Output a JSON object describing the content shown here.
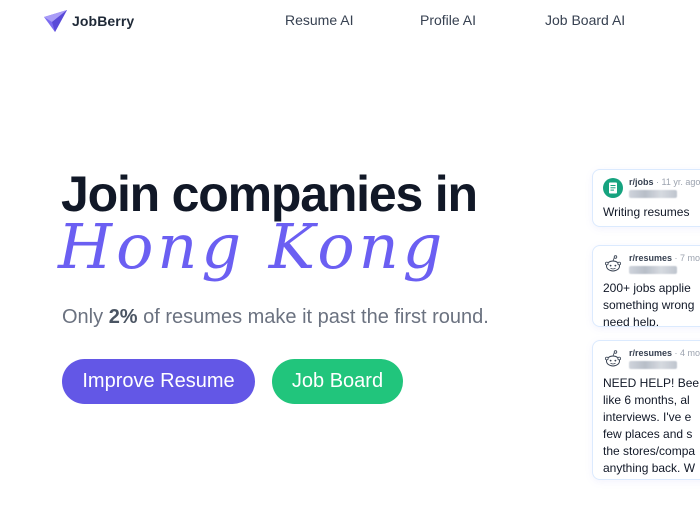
{
  "brand": {
    "name": "JobBerry",
    "accent": "#6357e6",
    "logo_icon": "paper-plane-icon"
  },
  "nav": [
    {
      "label": "Resume AI"
    },
    {
      "label": "Profile AI"
    },
    {
      "label": "Job Board AI"
    }
  ],
  "hero": {
    "headline": "Join companies in",
    "location": "Hong Kong",
    "sub_pre": "Only ",
    "sub_bold": "2%",
    "sub_post": " of resumes make it past the first round.",
    "primary_button": "Improve Resume",
    "secondary_button": "Job Board",
    "primary_color": "#6357e6",
    "secondary_color": "#21c57c"
  },
  "posts": [
    {
      "subreddit": "r/jobs",
      "time": "· 11 yr. ago",
      "icon": "document-icon",
      "text": "Writing resumes"
    },
    {
      "subreddit": "r/resumes",
      "time": "· 7 mo",
      "icon": "reddit-alien-icon",
      "text": "200+ jobs applie\nsomething wrong\nneed help."
    },
    {
      "subreddit": "r/resumes",
      "time": "· 4 mo",
      "icon": "reddit-alien-icon",
      "text": "NEED HELP! Bee\nlike 6 months, al\ninterviews. I've e\nfew places and s\nthe stores/compa\nanything back. W"
    }
  ]
}
